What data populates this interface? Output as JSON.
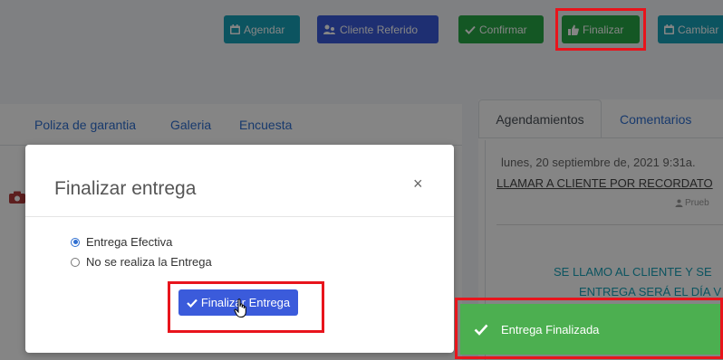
{
  "toolbar": {
    "agendar": "Agendar",
    "cliente_referido": "Cliente Referido",
    "confirmar": "Confirmar",
    "finalizar": "Finalizar",
    "cambiar": "Cambiar"
  },
  "left_tabs": [
    "Poliza de garantia",
    "Galeria",
    "Encuesta"
  ],
  "right_tabs": {
    "active": "Agendamientos",
    "other": "Comentarios"
  },
  "agenda_entry": {
    "date": "lunes, 20 septiembre de, 2021 9:31a.",
    "title": "LLAMAR A CLIENTE POR RECORDATO",
    "user": "Prueb",
    "message_line1": "SE LLAMO AL CLIENTE Y SE",
    "message_line2": "ENTREGA SERÁ EL DÍA V"
  },
  "modal": {
    "title": "Finalizar entrega",
    "close": "×",
    "options": [
      {
        "label": "Entrega Efectiva",
        "selected": true
      },
      {
        "label": "No se realiza la Entrega",
        "selected": false
      }
    ],
    "submit": "Finalizar Entrega"
  },
  "toast": {
    "message": "Entrega Finalizada"
  },
  "colors": {
    "info": "#17a2b8",
    "primary": "#3b5bdb",
    "success": "#28a745",
    "toast": "#4caf50",
    "highlight": "#e8141c"
  }
}
